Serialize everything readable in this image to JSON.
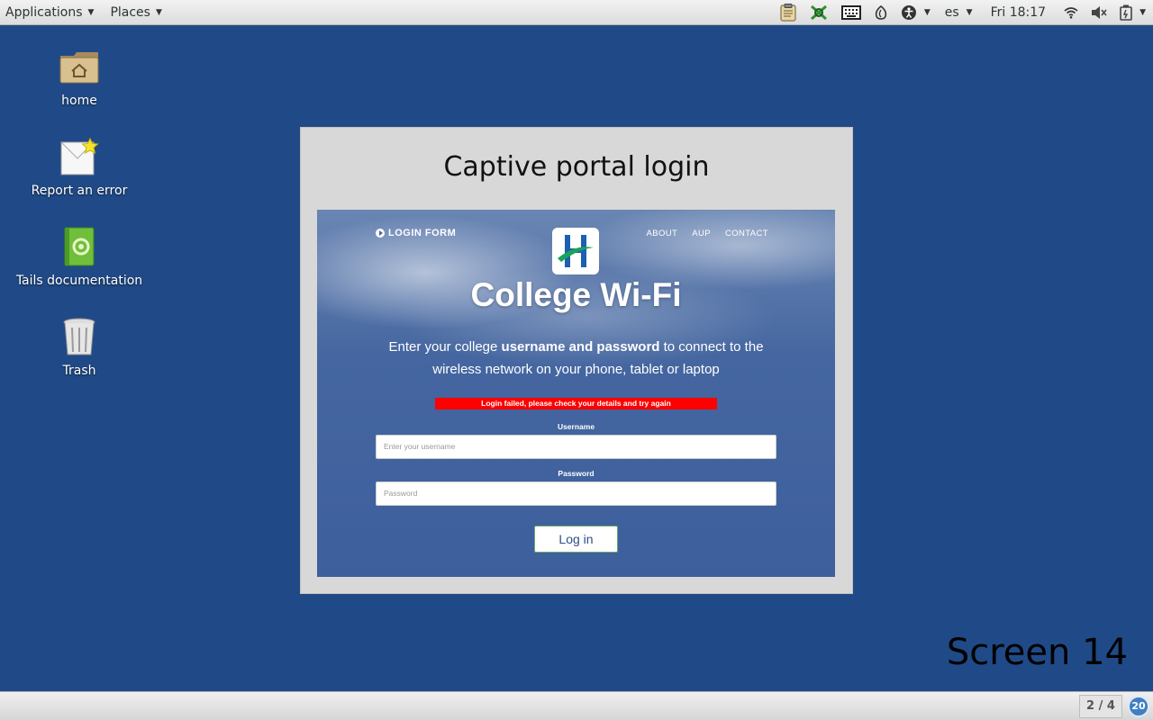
{
  "top_panel": {
    "applications_label": "Applications",
    "places_label": "Places",
    "language": "es",
    "clock": "Fri 18:17",
    "tray_icons": [
      "clipboard-icon",
      "vidalia-icon",
      "keyboard-icon",
      "tor-onion-icon",
      "accessibility-icon",
      "wifi-icon",
      "volume-icon",
      "battery-icon"
    ]
  },
  "desktop": {
    "icons": [
      {
        "label": "home",
        "icon": "home-folder-icon"
      },
      {
        "label": "Report an error",
        "icon": "report-error-icon"
      },
      {
        "label": "Tails documentation",
        "icon": "documentation-icon"
      },
      {
        "label": "Trash",
        "icon": "trash-icon"
      }
    ]
  },
  "dialog": {
    "title": "Captive portal login"
  },
  "portal": {
    "nav_left": "LOGIN FORM",
    "nav_links": [
      "ABOUT",
      "AUP",
      "CONTACT"
    ],
    "heading": "College Wi-Fi",
    "description_before": "Enter your college ",
    "description_bold": "username and password",
    "description_after": " to connect to the wireless network on your phone, tablet or laptop",
    "error": "Login failed, please check your details and try again",
    "username_label": "Username",
    "username_placeholder": "Enter your username",
    "password_label": "Password",
    "password_placeholder": "Password",
    "login_button": "Log in"
  },
  "screen_label": "Screen 14",
  "bottom_panel": {
    "workspace": "2 / 4",
    "notification_count": "20"
  },
  "colors": {
    "desktop_bg": "#204a87",
    "error_bg": "#ff0000"
  }
}
